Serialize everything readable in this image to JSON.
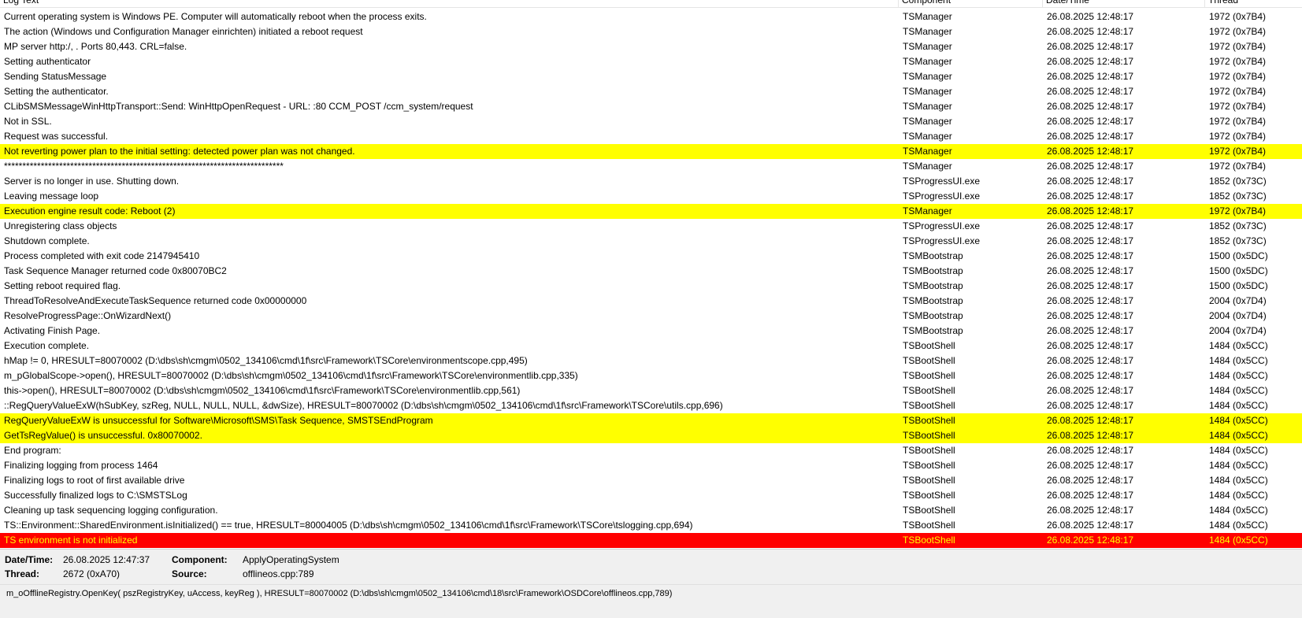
{
  "columns": {
    "text": "Log Text",
    "component": "Component",
    "datetime": "Date/Time",
    "thread": "Thread"
  },
  "colors": {
    "warning": "#ffff00",
    "error": "#ff0000",
    "error_text": "#ffff00"
  },
  "rows": [
    {
      "text": "Current operating system is Windows PE. Computer will automatically reboot when the process exits.",
      "component": "TSManager",
      "datetime": "26.08.2025 12:48:17",
      "thread": "1972 (0x7B4)",
      "level": "normal"
    },
    {
      "text": "The action (Windows und Configuration Manager einrichten) initiated a reboot request",
      "component": "TSManager",
      "datetime": "26.08.2025 12:48:17",
      "thread": "1972 (0x7B4)",
      "level": "normal"
    },
    {
      "text": "MP server http:/,                          . Ports 80,443. CRL=false.",
      "component": "TSManager",
      "datetime": "26.08.2025 12:48:17",
      "thread": "1972 (0x7B4)",
      "level": "normal"
    },
    {
      "text": "Setting authenticator",
      "component": "TSManager",
      "datetime": "26.08.2025 12:48:17",
      "thread": "1972 (0x7B4)",
      "level": "normal"
    },
    {
      "text": "Sending StatusMessage",
      "component": "TSManager",
      "datetime": "26.08.2025 12:48:17",
      "thread": "1972 (0x7B4)",
      "level": "normal"
    },
    {
      "text": "Setting the authenticator.",
      "component": "TSManager",
      "datetime": "26.08.2025 12:48:17",
      "thread": "1972 (0x7B4)",
      "level": "normal"
    },
    {
      "text": "CLibSMSMessageWinHttpTransport::Send: WinHttpOpenRequest - URL:                                     :80  CCM_POST /ccm_system/request",
      "component": "TSManager",
      "datetime": "26.08.2025 12:48:17",
      "thread": "1972 (0x7B4)",
      "level": "normal"
    },
    {
      "text": "Not in SSL.",
      "component": "TSManager",
      "datetime": "26.08.2025 12:48:17",
      "thread": "1972 (0x7B4)",
      "level": "normal"
    },
    {
      "text": "Request was successful.",
      "component": "TSManager",
      "datetime": "26.08.2025 12:48:17",
      "thread": "1972 (0x7B4)",
      "level": "normal"
    },
    {
      "text": "Not reverting power plan to the initial setting: detected power plan was not changed.",
      "component": "TSManager",
      "datetime": "26.08.2025 12:48:17",
      "thread": "1972 (0x7B4)",
      "level": "warn"
    },
    {
      "text": "****************************************************************************",
      "component": "TSManager",
      "datetime": "26.08.2025 12:48:17",
      "thread": "1972 (0x7B4)",
      "level": "normal"
    },
    {
      "text": "Server is no longer in use. Shutting down.",
      "component": "TSProgressUI.exe",
      "datetime": "26.08.2025 12:48:17",
      "thread": "1852 (0x73C)",
      "level": "normal"
    },
    {
      "text": "Leaving message loop",
      "component": "TSProgressUI.exe",
      "datetime": "26.08.2025 12:48:17",
      "thread": "1852 (0x73C)",
      "level": "normal"
    },
    {
      "text": "Execution engine result code: Reboot (2)",
      "component": "TSManager",
      "datetime": "26.08.2025 12:48:17",
      "thread": "1972 (0x7B4)",
      "level": "warn"
    },
    {
      "text": "Unregistering class objects",
      "component": "TSProgressUI.exe",
      "datetime": "26.08.2025 12:48:17",
      "thread": "1852 (0x73C)",
      "level": "normal"
    },
    {
      "text": "Shutdown complete.",
      "component": "TSProgressUI.exe",
      "datetime": "26.08.2025 12:48:17",
      "thread": "1852 (0x73C)",
      "level": "normal"
    },
    {
      "text": "Process completed with exit code 2147945410",
      "component": "TSMBootstrap",
      "datetime": "26.08.2025 12:48:17",
      "thread": "1500 (0x5DC)",
      "level": "normal"
    },
    {
      "text": "Task Sequence Manager returned code 0x80070BC2",
      "component": "TSMBootstrap",
      "datetime": "26.08.2025 12:48:17",
      "thread": "1500 (0x5DC)",
      "level": "normal"
    },
    {
      "text": "Setting reboot required flag.",
      "component": "TSMBootstrap",
      "datetime": "26.08.2025 12:48:17",
      "thread": "1500 (0x5DC)",
      "level": "normal"
    },
    {
      "text": "ThreadToResolveAndExecuteTaskSequence returned code 0x00000000",
      "component": "TSMBootstrap",
      "datetime": "26.08.2025 12:48:17",
      "thread": "2004 (0x7D4)",
      "level": "normal"
    },
    {
      "text": "ResolveProgressPage::OnWizardNext()",
      "component": "TSMBootstrap",
      "datetime": "26.08.2025 12:48:17",
      "thread": "2004 (0x7D4)",
      "level": "normal"
    },
    {
      "text": "Activating Finish Page.",
      "component": "TSMBootstrap",
      "datetime": "26.08.2025 12:48:17",
      "thread": "2004 (0x7D4)",
      "level": "normal"
    },
    {
      "text": "Execution complete.",
      "component": "TSBootShell",
      "datetime": "26.08.2025 12:48:17",
      "thread": "1484 (0x5CC)",
      "level": "normal"
    },
    {
      "text": "hMap != 0, HRESULT=80070002 (D:\\dbs\\sh\\cmgm\\0502_134106\\cmd\\1f\\src\\Framework\\TSCore\\environmentscope.cpp,495)",
      "component": "TSBootShell",
      "datetime": "26.08.2025 12:48:17",
      "thread": "1484 (0x5CC)",
      "level": "normal"
    },
    {
      "text": "m_pGlobalScope->open(), HRESULT=80070002 (D:\\dbs\\sh\\cmgm\\0502_134106\\cmd\\1f\\src\\Framework\\TSCore\\environmentlib.cpp,335)",
      "component": "TSBootShell",
      "datetime": "26.08.2025 12:48:17",
      "thread": "1484 (0x5CC)",
      "level": "normal"
    },
    {
      "text": "this->open(), HRESULT=80070002 (D:\\dbs\\sh\\cmgm\\0502_134106\\cmd\\1f\\src\\Framework\\TSCore\\environmentlib.cpp,561)",
      "component": "TSBootShell",
      "datetime": "26.08.2025 12:48:17",
      "thread": "1484 (0x5CC)",
      "level": "normal"
    },
    {
      "text": "::RegQueryValueExW(hSubKey, szReg, NULL, NULL, NULL, &dwSize), HRESULT=80070002 (D:\\dbs\\sh\\cmgm\\0502_134106\\cmd\\1f\\src\\Framework\\TSCore\\utils.cpp,696)",
      "component": "TSBootShell",
      "datetime": "26.08.2025 12:48:17",
      "thread": "1484 (0x5CC)",
      "level": "normal"
    },
    {
      "text": "RegQueryValueExW is unsuccessful for Software\\Microsoft\\SMS\\Task Sequence, SMSTSEndProgram",
      "component": "TSBootShell",
      "datetime": "26.08.2025 12:48:17",
      "thread": "1484 (0x5CC)",
      "level": "warn"
    },
    {
      "text": "GetTsRegValue() is unsuccessful. 0x80070002.",
      "component": "TSBootShell",
      "datetime": "26.08.2025 12:48:17",
      "thread": "1484 (0x5CC)",
      "level": "warn"
    },
    {
      "text": "End program:",
      "component": "TSBootShell",
      "datetime": "26.08.2025 12:48:17",
      "thread": "1484 (0x5CC)",
      "level": "normal"
    },
    {
      "text": "Finalizing logging from process 1464",
      "component": "TSBootShell",
      "datetime": "26.08.2025 12:48:17",
      "thread": "1484 (0x5CC)",
      "level": "normal"
    },
    {
      "text": "Finalizing logs to root of first available drive",
      "component": "TSBootShell",
      "datetime": "26.08.2025 12:48:17",
      "thread": "1484 (0x5CC)",
      "level": "normal"
    },
    {
      "text": "Successfully finalized logs to C:\\SMSTSLog",
      "component": "TSBootShell",
      "datetime": "26.08.2025 12:48:17",
      "thread": "1484 (0x5CC)",
      "level": "normal"
    },
    {
      "text": "Cleaning up task sequencing logging configuration.",
      "component": "TSBootShell",
      "datetime": "26.08.2025 12:48:17",
      "thread": "1484 (0x5CC)",
      "level": "normal"
    },
    {
      "text": "TS::Environment::SharedEnvironment.isInitialized() == true, HRESULT=80004005 (D:\\dbs\\sh\\cmgm\\0502_134106\\cmd\\1f\\src\\Framework\\TSCore\\tslogging.cpp,694)",
      "component": "TSBootShell",
      "datetime": "26.08.2025 12:48:17",
      "thread": "1484 (0x5CC)",
      "level": "normal"
    },
    {
      "text": "TS environment is not initialized",
      "component": "TSBootShell",
      "datetime": "26.08.2025 12:48:17",
      "thread": "1484 (0x5CC)",
      "level": "err"
    }
  ],
  "details": {
    "datetime_label": "Date/Time:",
    "datetime_value": "26.08.2025 12:47:37",
    "component_label": "Component:",
    "component_value": "ApplyOperatingSystem",
    "thread_label": "Thread:",
    "thread_value": "2672 (0xA70)",
    "source_label": "Source:",
    "source_value": "offlineos.cpp:789",
    "message": "m_oOfflineRegistry.OpenKey( pszRegistryKey, uAccess, keyReg ), HRESULT=80070002 (D:\\dbs\\sh\\cmgm\\0502_134106\\cmd\\18\\src\\Framework\\OSDCore\\offlineos.cpp,789)"
  }
}
